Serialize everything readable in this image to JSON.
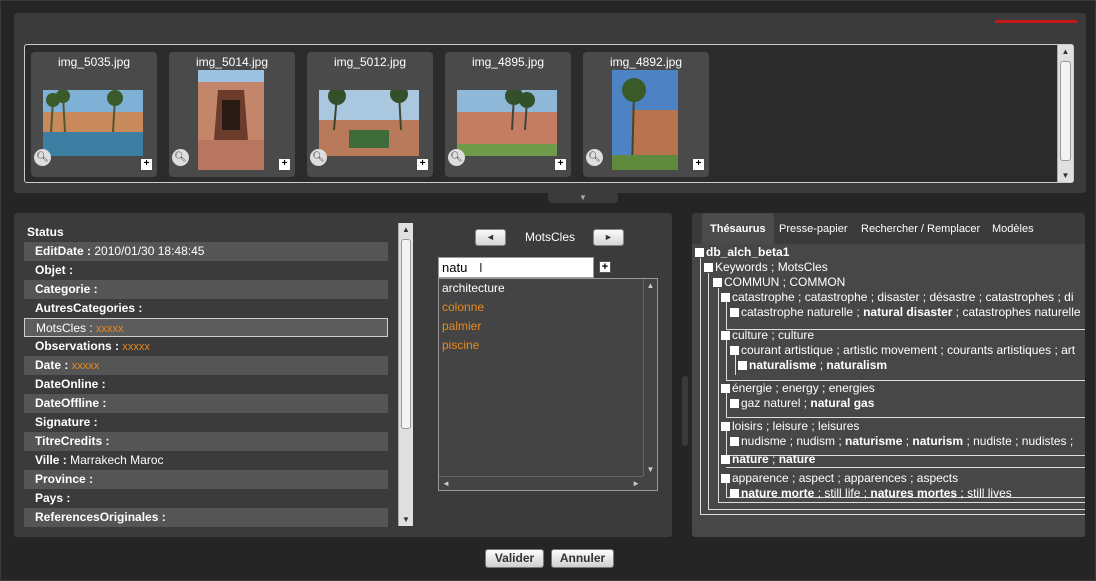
{
  "thumbnails": [
    {
      "name": "img_5035.jpg"
    },
    {
      "name": "img_5014.jpg"
    },
    {
      "name": "img_5012.jpg"
    },
    {
      "name": "img_4895.jpg"
    },
    {
      "name": "img_4892.jpg"
    }
  ],
  "thumb_icons": {
    "zoom": "magnifier-icon",
    "add": "plus-icon"
  },
  "fields": [
    {
      "label": "Status",
      "value": "",
      "style": "status"
    },
    {
      "label": "EditDate : ",
      "value": "2010/01/30 18:48:45",
      "style": "odd"
    },
    {
      "label": "Objet : ",
      "value": "",
      "style": "even"
    },
    {
      "label": "Categorie : ",
      "value": "",
      "style": "odd"
    },
    {
      "label": "AutresCategories : ",
      "value": "",
      "style": "even"
    },
    {
      "label": "MotsCles : ",
      "value": "xxxxx",
      "style": "selected",
      "orange": true
    },
    {
      "label": "Observations : ",
      "value": "xxxxx",
      "style": "even",
      "orange": true
    },
    {
      "label": "Date : ",
      "value": "xxxxx",
      "style": "odd",
      "orange": true
    },
    {
      "label": "DateOnline : ",
      "value": "",
      "style": "even"
    },
    {
      "label": "DateOffline : ",
      "value": "",
      "style": "odd"
    },
    {
      "label": "Signature : ",
      "value": "",
      "style": "even"
    },
    {
      "label": "TitreCredits : ",
      "value": "",
      "style": "odd"
    },
    {
      "label": "Ville : ",
      "value": "Marrakech Maroc",
      "style": "even"
    },
    {
      "label": "Province : ",
      "value": "",
      "style": "odd"
    },
    {
      "label": "Pays : ",
      "value": "",
      "style": "even"
    },
    {
      "label": "ReferencesOriginales : ",
      "value": "",
      "style": "odd"
    }
  ],
  "keywords": {
    "title": "MotsCles",
    "prev_icon": "◄",
    "next_icon": "►",
    "input_value": "natu",
    "add_label": "+",
    "items": [
      {
        "text": "architecture",
        "color": "white"
      },
      {
        "text": "colonne",
        "color": "orange"
      },
      {
        "text": "palmier",
        "color": "orange"
      },
      {
        "text": "piscine",
        "color": "orange"
      }
    ]
  },
  "tabs": [
    "Thésaurus",
    "Presse-papier",
    "Rechercher / Remplacer",
    "Modèles"
  ],
  "tree": {
    "root": "db_alch_beta1",
    "keywords": "Keywords ; MotsCles",
    "commun": "COMMUN ; COMMON",
    "cat1": "catastrophe ; catastrophe ; disaster ; désastre ; catastrophes ; di",
    "cat1_child_a": "catastrophe naturelle ; ",
    "cat1_child_b": "natural disaster",
    "cat1_child_c": " ; catastrophes naturelle",
    "cat2": "culture ; culture",
    "cat2_child": "courant artistique ; artistic movement ; courants artistiques ; art",
    "cat2_leaf_a": "naturalisme",
    "cat2_leaf_sep": " ; ",
    "cat2_leaf_b": "naturalism",
    "cat3": "énergie ; energy ; energies",
    "cat3_child_a": "gaz naturel ; ",
    "cat3_child_b": "natural gas",
    "cat4": "loisirs ; leisure ; leisures",
    "cat4_child_a": "nudisme ; nudism ; ",
    "cat4_child_b": "naturisme",
    "cat4_child_sep": " ; ",
    "cat4_child_c": "naturism",
    "cat4_child_d": " ; nudiste ; nudistes ;",
    "cat5_a": "nature",
    "cat5_sep": " ; ",
    "cat5_b": "nature",
    "cat6": "apparence ; aspect ; apparences ; aspects",
    "cat6_child_a": "nature morte",
    "cat6_child_b": " ; still life ; ",
    "cat6_child_c": "natures mortes",
    "cat6_child_d": " ; still lives"
  },
  "buttons": {
    "validate": "Valider",
    "cancel": "Annuler"
  },
  "colors": {
    "accent_orange": "#e88a1e",
    "bar_red": "#c21b1b",
    "panel": "#3b3b3b"
  }
}
